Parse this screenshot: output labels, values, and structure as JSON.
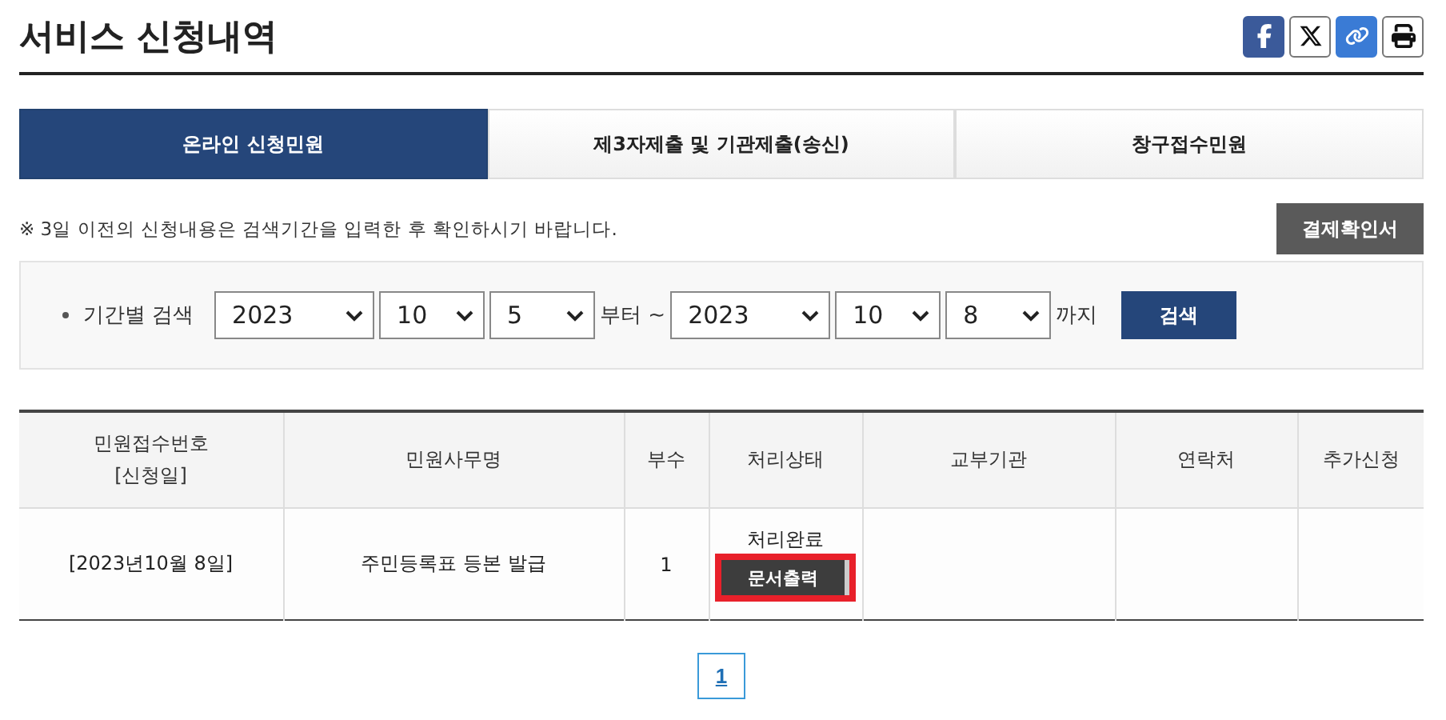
{
  "header": {
    "title": "서비스 신청내역",
    "share_buttons": [
      {
        "kind": "facebook"
      },
      {
        "kind": "x"
      },
      {
        "kind": "link"
      },
      {
        "kind": "print"
      }
    ]
  },
  "tabs": [
    {
      "label": "온라인 신청민원",
      "selected": true
    },
    {
      "label": "제3자제출 및 기관제출(송신)",
      "selected": false
    },
    {
      "label": "창구접수민원",
      "selected": false
    }
  ],
  "notice": "※ 3일 이전의 신청내용은 검색기간을 입력한 후 확인하시기 바랍니다.",
  "payment_button": "결제확인서",
  "search": {
    "label": "기간별 검색",
    "from": [
      "2023",
      "10",
      "5"
    ],
    "from_suffix": "부터 ~",
    "to": [
      "2023",
      "10",
      "8"
    ],
    "to_suffix": "까지",
    "button": "검색"
  },
  "table": {
    "columns": [
      [
        "민원접수번호",
        "[신청일]"
      ],
      [
        "민원사무명"
      ],
      [
        "부수"
      ],
      [
        "처리상태"
      ],
      [
        "교부기관"
      ],
      [
        "연락처"
      ],
      [
        "추가신청"
      ]
    ],
    "rows": [
      {
        "date": "[2023년10월 8일]",
        "name": "주민등록표 등본 발급",
        "copies": "1",
        "status": "처리완료",
        "action": "문서출력",
        "highlighted": true
      }
    ]
  },
  "pagination": [
    {
      "label": "1",
      "selected": true
    }
  ]
}
